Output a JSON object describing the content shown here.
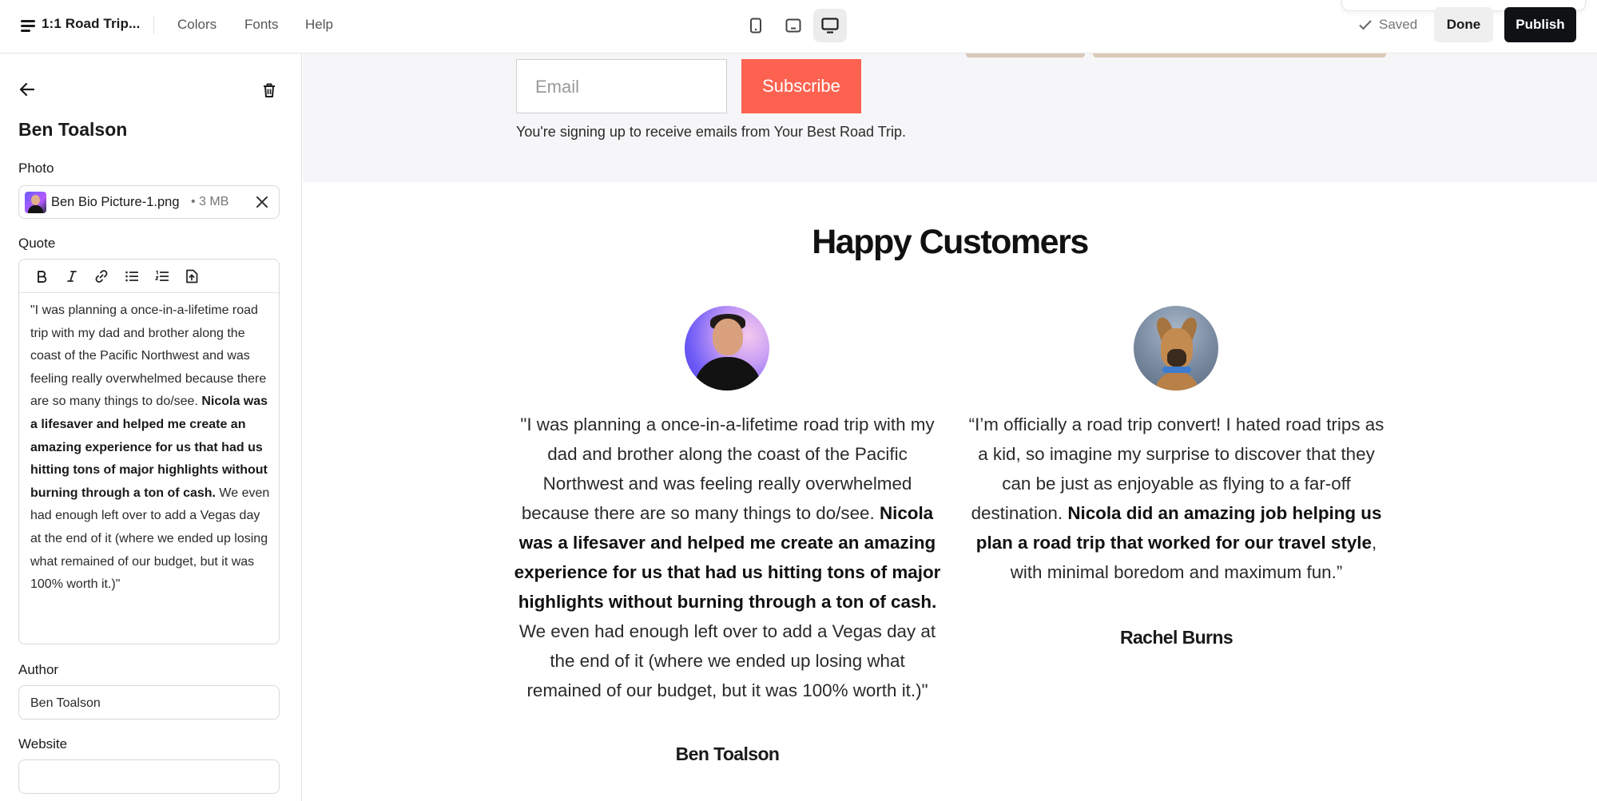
{
  "topbar": {
    "project_title": "1:1 Road Trip...",
    "nav": [
      "Colors",
      "Fonts",
      "Help"
    ],
    "devices": [
      "mobile",
      "tablet",
      "desktop"
    ],
    "active_device": "desktop",
    "saved_label": "Saved",
    "done_label": "Done",
    "publish_label": "Publish"
  },
  "sidebar": {
    "title": "Ben Toalson",
    "photo_label": "Photo",
    "photo_file": "Ben Bio Picture-1.png",
    "photo_size": "• 3 MB",
    "quote_label": "Quote",
    "quote_parts": [
      {
        "text": "\"I was planning a once-in-a-lifetime road trip with my dad and brother along the coast of the Pacific Northwest and was feeling really overwhelmed because there are so many things to do/see. ",
        "bold": false
      },
      {
        "text": "Nicola was a lifesaver and helped me create an amazing experience for us that had us hitting tons of major highlights without burning through a ton of cash.",
        "bold": true
      },
      {
        "text": " We even had enough left over to add a Vegas day at the end of it (where we ended up losing what remained of our budget, but it was 100% worth it.)\"",
        "bold": false
      }
    ],
    "author_label": "Author",
    "author_value": "Ben Toalson",
    "website_label": "Website",
    "website_value": ""
  },
  "signup": {
    "email_placeholder": "Email",
    "subscribe_label": "Subscribe",
    "note": "You're signing up to receive emails from Your Best Road Trip."
  },
  "testimonials": {
    "title": "Happy Customers",
    "items": [
      {
        "author": "Ben Toalson",
        "quote_parts": [
          {
            "text": "\"I was planning a once-in-a-lifetime road trip with my dad and brother along the coast of the Pacific Northwest and was feeling really overwhelmed because there are so many things to do/see. ",
            "bold": false
          },
          {
            "text": "Nicola was a lifesaver and helped me create an amazing experience for us that had us hitting tons of major highlights without burning through a ton of cash.",
            "bold": true
          },
          {
            "text": " We even had enough left over to add a Vegas day at the end of it (where we ended up losing what remained of our budget, but it was 100% worth it.)\"",
            "bold": false
          }
        ]
      },
      {
        "author": "Rachel Burns",
        "quote_parts": [
          {
            "text": "“I’m officially a road trip convert! I hated road trips as a kid, so imagine my surprise to discover that they can be just as enjoyable as flying to a far-off destination. ",
            "bold": false
          },
          {
            "text": "Nicola did an amazing job helping us plan a road trip that worked for our travel style",
            "bold": true
          },
          {
            "text": ", with minimal boredom and maximum fun.”",
            "bold": false
          }
        ]
      }
    ]
  },
  "colors": {
    "accent": "#fd6250",
    "publish_bg": "#0f1215",
    "signup_bg": "#f6f6f8"
  }
}
